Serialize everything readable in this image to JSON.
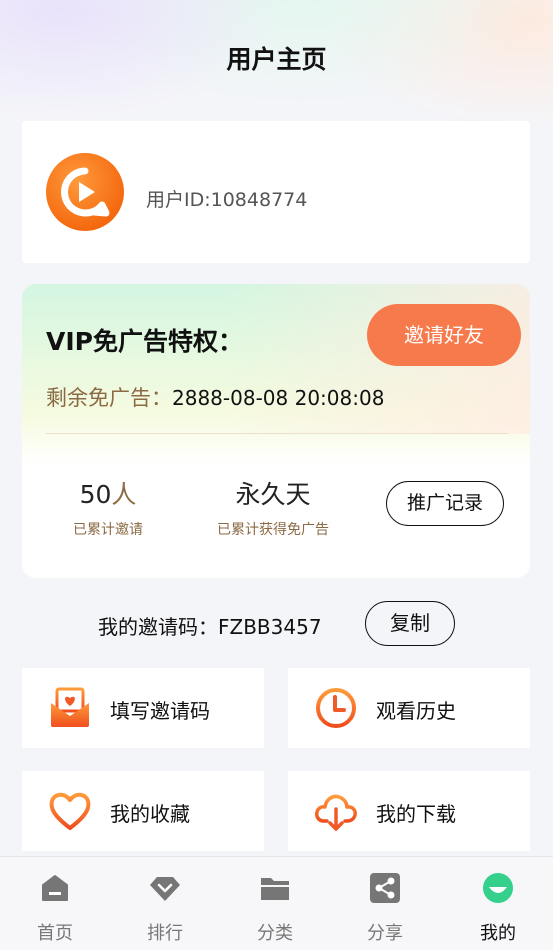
{
  "header": {
    "title": "用户主页"
  },
  "profile": {
    "user_id_text": "用户ID:10848774"
  },
  "vip": {
    "title": "VIP免广告特权：",
    "invite_button": "邀请好友",
    "remaining_label": "剩余免广告：",
    "remaining_value": "2888-08-08 20:08:08",
    "stats": [
      {
        "number": "50",
        "unit": "人",
        "caption": "已累计邀请"
      },
      {
        "number": "永久天",
        "unit": "",
        "caption": "已累计获得免广告"
      }
    ],
    "promo_button": "推广记录"
  },
  "invite_code": {
    "label": "我的邀请码：",
    "code": "FZBB3457",
    "copy_button": "复制"
  },
  "menu": [
    {
      "label": "填写邀请码",
      "icon": "mail-heart-icon"
    },
    {
      "label": "观看历史",
      "icon": "clock-icon"
    },
    {
      "label": "我的收藏",
      "icon": "heart-icon"
    },
    {
      "label": "我的下载",
      "icon": "cloud-download-icon"
    }
  ],
  "tabbar": {
    "items": [
      {
        "label": "首页",
        "icon": "home-icon"
      },
      {
        "label": "排行",
        "icon": "diamond-icon"
      },
      {
        "label": "分类",
        "icon": "folder-icon"
      },
      {
        "label": "分享",
        "icon": "share-icon"
      },
      {
        "label": "我的",
        "icon": "profile-face-icon"
      }
    ],
    "active_index": 4
  },
  "colors": {
    "accent": "#f77a4c",
    "brown_text": "#8b6a44",
    "active_tab": "#35d08c"
  }
}
